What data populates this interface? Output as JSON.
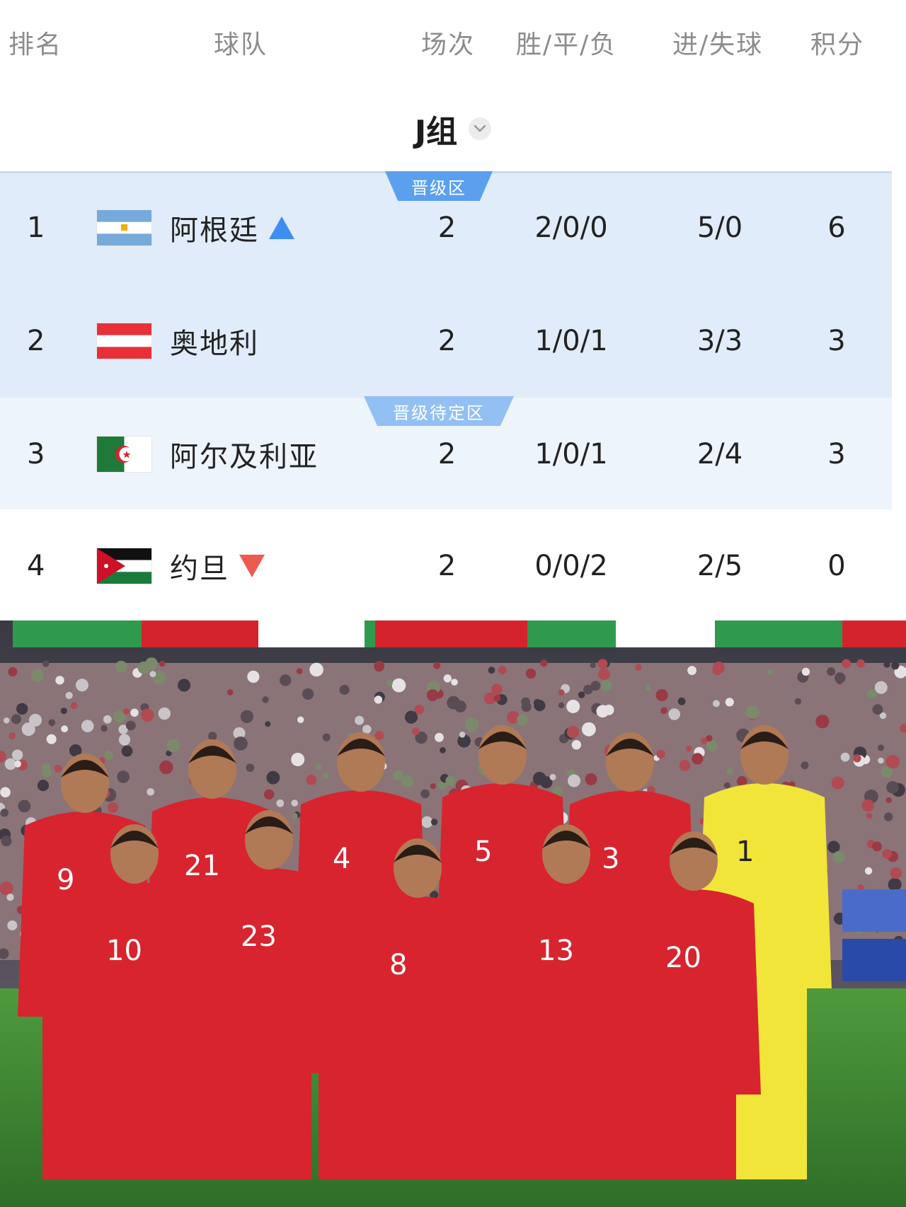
{
  "header": {
    "rank": "排名",
    "team": "球队",
    "played": "场次",
    "wdl": "胜/平/负",
    "goals": "进/失球",
    "points": "积分"
  },
  "group": {
    "label": "J组",
    "dropdown_icon": "chevron-down-icon"
  },
  "zones": {
    "qualified": "晋级区",
    "pending": "晋级待定区"
  },
  "rows": [
    {
      "rank": "1",
      "team": "阿根廷",
      "flag": "argentina",
      "played": "2",
      "wdl": "2/0/0",
      "goals": "5/0",
      "points": "6",
      "trend": "up"
    },
    {
      "rank": "2",
      "team": "奥地利",
      "flag": "austria",
      "played": "2",
      "wdl": "1/0/1",
      "goals": "3/3",
      "points": "3",
      "trend": "none"
    },
    {
      "rank": "3",
      "team": "阿尔及利亚",
      "flag": "algeria",
      "played": "2",
      "wdl": "1/0/1",
      "goals": "2/4",
      "points": "3",
      "trend": "none"
    },
    {
      "rank": "4",
      "team": "约旦",
      "flag": "jordan",
      "played": "2",
      "wdl": "0/0/2",
      "goals": "2/5",
      "points": "0",
      "trend": "down"
    }
  ],
  "photo": {
    "jersey_numbers": [
      "9",
      "21",
      "4",
      "5",
      "3",
      "1",
      "10",
      "23",
      "8",
      "13",
      "20"
    ]
  },
  "colors": {
    "qualified_bg": "#e0ecf9",
    "pending_bg": "#eef4fc",
    "up": "#3d8ef0",
    "down": "#ef5a50",
    "jersey": "#d8242e",
    "keeper": "#f2e53a"
  }
}
